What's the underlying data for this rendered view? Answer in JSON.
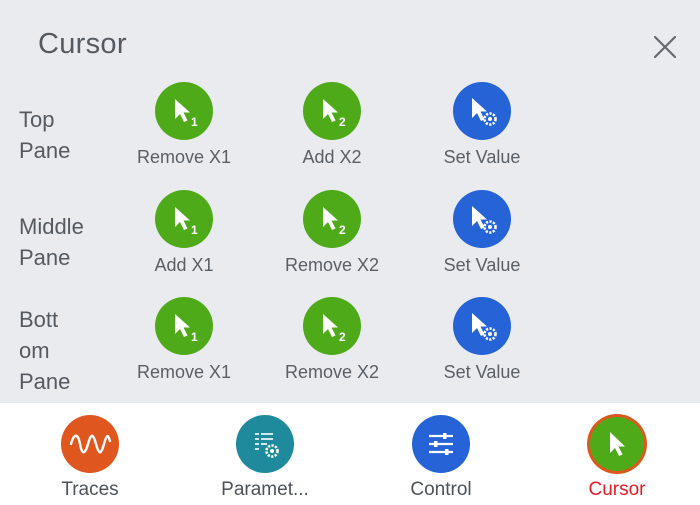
{
  "dialog": {
    "title": "Cursor",
    "close_icon": "close-icon"
  },
  "rows": [
    {
      "label": "Top\nPane",
      "buttons": [
        {
          "label": "Remove X1",
          "icon": "cursor-x1-icon",
          "color": "#4faa1a"
        },
        {
          "label": "Add X2",
          "icon": "cursor-x2-icon",
          "color": "#4faa1a"
        },
        {
          "label": "Set Value",
          "icon": "cursor-settings-icon",
          "color": "#2563d6"
        }
      ]
    },
    {
      "label": "Middle\nPane",
      "buttons": [
        {
          "label": "Add X1",
          "icon": "cursor-x1-icon",
          "color": "#4faa1a"
        },
        {
          "label": "Remove X2",
          "icon": "cursor-x2-icon",
          "color": "#4faa1a"
        },
        {
          "label": "Set Value",
          "icon": "cursor-settings-icon",
          "color": "#2563d6"
        }
      ]
    },
    {
      "label": "Bott\nom\nPane",
      "buttons": [
        {
          "label": "Remove X1",
          "icon": "cursor-x1-icon",
          "color": "#4faa1a"
        },
        {
          "label": "Remove X2",
          "icon": "cursor-x2-icon",
          "color": "#4faa1a"
        },
        {
          "label": "Set Value",
          "icon": "cursor-settings-icon",
          "color": "#2563d6"
        }
      ]
    }
  ],
  "tabs": [
    {
      "label": "Traces",
      "icon": "waveform-icon",
      "color": "#e0561f",
      "active": false
    },
    {
      "label": "Paramet...",
      "icon": "parameters-icon",
      "color": "#1f8a9c",
      "active": false
    },
    {
      "label": "Control",
      "icon": "sliders-icon",
      "color": "#2563d6",
      "active": false
    },
    {
      "label": "Cursor",
      "icon": "cursor-icon",
      "color": "#4faa1a",
      "active": true
    }
  ],
  "colors": {
    "panel_bg": "#e9ebee",
    "active_tab_text": "#e11d2a",
    "cursor_ring": "#e0561f"
  }
}
